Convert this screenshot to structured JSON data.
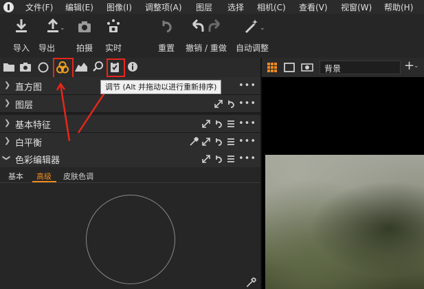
{
  "menubar": {
    "items": [
      "文件(F)",
      "编辑(E)",
      "图像(I)",
      "调整项(A)",
      "图层",
      "选择",
      "相机(C)",
      "查看(V)",
      "视窗(W)",
      "帮助(H)"
    ]
  },
  "toolbar": {
    "import_label": "导入",
    "export_label": "导出",
    "capture_label": "拍摄",
    "live_label": "实时",
    "reset_label": "重置",
    "undo_redo_label": "撤销 / 重做",
    "auto_adjust_label": "自动调整"
  },
  "viewer": {
    "layer_select": "背景"
  },
  "tooltip": {
    "text": "调节 (Alt 并拖动以进行重新排序)"
  },
  "panels": {
    "histogram": "直方图",
    "layers": "图层",
    "base_characteristics": "基本特征",
    "white_balance": "白平衡",
    "color_editor": "色彩编辑器"
  },
  "color_editor": {
    "tabs": [
      "基本",
      "高级",
      "皮肤色调"
    ],
    "active_tab": "高级"
  },
  "colors": {
    "accent": "#f08a1c",
    "highlight": "#e8261c",
    "color_tab_icon": "#f0a020"
  }
}
